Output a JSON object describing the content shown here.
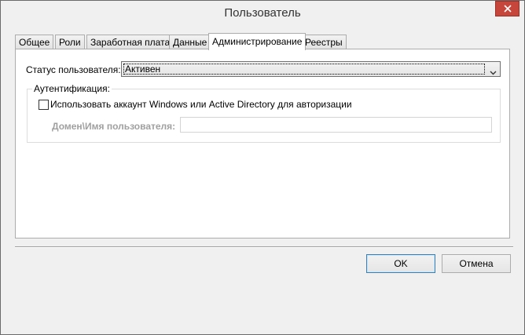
{
  "window": {
    "title": "Пользователь"
  },
  "tabs": [
    {
      "label": "Общее"
    },
    {
      "label": "Роли"
    },
    {
      "label": "Заработная плата"
    },
    {
      "label": "Данные"
    },
    {
      "label": "Администрирование",
      "active": true
    },
    {
      "label": "Реестры"
    }
  ],
  "admin": {
    "status_label": "Статус пользователя:",
    "status_value": "Активен",
    "auth_group_label": "Аутентификация:",
    "windows_auth_label": "Использовать аккаунт Windows или Active Directory для авторизации",
    "windows_auth_checked": false,
    "domain_label": "Домен\\Имя пользователя:",
    "domain_value": ""
  },
  "buttons": {
    "ok_label": "OK",
    "cancel_label": "Отмена"
  },
  "icons": {
    "close": "close-icon",
    "dropdown": "chevron-down-icon"
  },
  "colors": {
    "close_button": "#c7463c",
    "default_button_border": "#3c7fb1"
  }
}
